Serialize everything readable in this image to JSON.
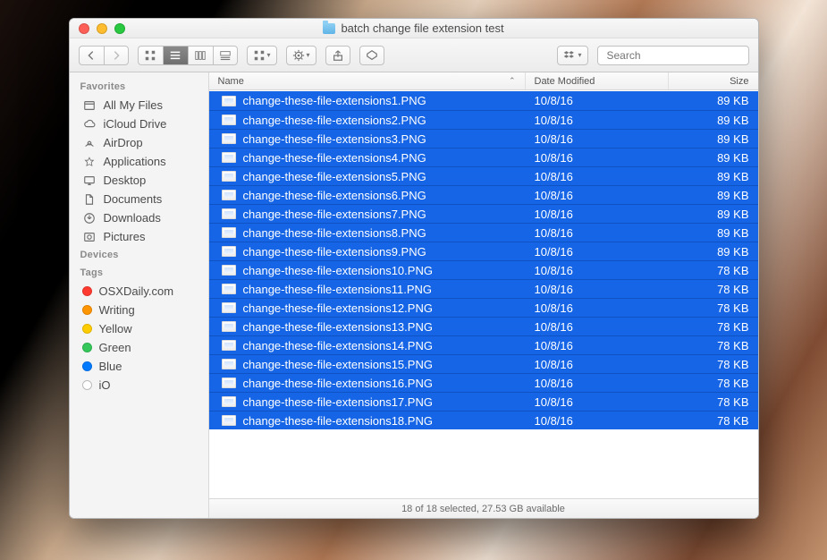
{
  "window": {
    "title": "batch change file extension test"
  },
  "toolbar": {
    "search_placeholder": "Search"
  },
  "sidebar": {
    "favorites_label": "Favorites",
    "favorites": [
      {
        "icon": "all-my-files",
        "label": "All My Files"
      },
      {
        "icon": "icloud",
        "label": "iCloud Drive"
      },
      {
        "icon": "airdrop",
        "label": "AirDrop"
      },
      {
        "icon": "applications",
        "label": "Applications"
      },
      {
        "icon": "desktop",
        "label": "Desktop"
      },
      {
        "icon": "documents",
        "label": "Documents"
      },
      {
        "icon": "downloads",
        "label": "Downloads"
      },
      {
        "icon": "pictures",
        "label": "Pictures"
      }
    ],
    "devices_label": "Devices",
    "tags_label": "Tags",
    "tags": [
      {
        "color": "#ff3b30",
        "label": "OSXDaily.com"
      },
      {
        "color": "#ff9500",
        "label": "Writing"
      },
      {
        "color": "#ffcc00",
        "label": "Yellow"
      },
      {
        "color": "#34c759",
        "label": "Green"
      },
      {
        "color": "#007aff",
        "label": "Blue"
      },
      {
        "color": "#ffffff",
        "label": "iO"
      }
    ]
  },
  "columns": {
    "name": "Name",
    "date": "Date Modified",
    "size": "Size"
  },
  "files": [
    {
      "name": "change-these-file-extensions1.PNG",
      "date": "10/8/16",
      "size": "89 KB"
    },
    {
      "name": "change-these-file-extensions2.PNG",
      "date": "10/8/16",
      "size": "89 KB"
    },
    {
      "name": "change-these-file-extensions3.PNG",
      "date": "10/8/16",
      "size": "89 KB"
    },
    {
      "name": "change-these-file-extensions4.PNG",
      "date": "10/8/16",
      "size": "89 KB"
    },
    {
      "name": "change-these-file-extensions5.PNG",
      "date": "10/8/16",
      "size": "89 KB"
    },
    {
      "name": "change-these-file-extensions6.PNG",
      "date": "10/8/16",
      "size": "89 KB"
    },
    {
      "name": "change-these-file-extensions7.PNG",
      "date": "10/8/16",
      "size": "89 KB"
    },
    {
      "name": "change-these-file-extensions8.PNG",
      "date": "10/8/16",
      "size": "89 KB"
    },
    {
      "name": "change-these-file-extensions9.PNG",
      "date": "10/8/16",
      "size": "89 KB"
    },
    {
      "name": "change-these-file-extensions10.PNG",
      "date": "10/8/16",
      "size": "78 KB"
    },
    {
      "name": "change-these-file-extensions11.PNG",
      "date": "10/8/16",
      "size": "78 KB"
    },
    {
      "name": "change-these-file-extensions12.PNG",
      "date": "10/8/16",
      "size": "78 KB"
    },
    {
      "name": "change-these-file-extensions13.PNG",
      "date": "10/8/16",
      "size": "78 KB"
    },
    {
      "name": "change-these-file-extensions14.PNG",
      "date": "10/8/16",
      "size": "78 KB"
    },
    {
      "name": "change-these-file-extensions15.PNG",
      "date": "10/8/16",
      "size": "78 KB"
    },
    {
      "name": "change-these-file-extensions16.PNG",
      "date": "10/8/16",
      "size": "78 KB"
    },
    {
      "name": "change-these-file-extensions17.PNG",
      "date": "10/8/16",
      "size": "78 KB"
    },
    {
      "name": "change-these-file-extensions18.PNG",
      "date": "10/8/16",
      "size": "78 KB"
    }
  ],
  "status": {
    "text": "18 of 18 selected, 27.53 GB available"
  }
}
